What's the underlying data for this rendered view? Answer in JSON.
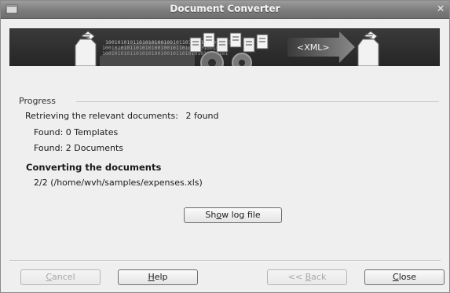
{
  "window": {
    "title": "Document Converter"
  },
  "banner": {
    "binary_text": "10010101011010101001001011010101010010101",
    "xml_text": "<XML>"
  },
  "progress": {
    "group_label": "Progress",
    "retrieving_label": "Retrieving the relevant documents:",
    "found_count": "2  found",
    "templates_line": "Found: 0 Templates",
    "documents_line": "Found: 2 Documents",
    "converting_heading": "Converting the documents",
    "current_file_line": "2/2  (/home/wvh/samples/expenses.xls)"
  },
  "buttons": {
    "show_log": {
      "prefix": "Sh",
      "mnemonic": "o",
      "suffix": "w log file"
    },
    "cancel": {
      "prefix": "",
      "mnemonic": "C",
      "suffix": "ancel",
      "enabled": false
    },
    "help": {
      "prefix": "",
      "mnemonic": "H",
      "suffix": "elp",
      "enabled": true
    },
    "back": {
      "prefix": "<< ",
      "mnemonic": "B",
      "suffix": "ack",
      "enabled": false
    },
    "close": {
      "prefix": "",
      "mnemonic": "C",
      "suffix": "lose",
      "enabled": true
    }
  },
  "icons": {
    "window_icon": "document-icon",
    "close_icon": "close-x-icon",
    "banner_icons": [
      "document-icon",
      "binary-swirl",
      "documents-stack-icon",
      "gears-icon",
      "arrow-icon",
      "document-icon"
    ]
  }
}
